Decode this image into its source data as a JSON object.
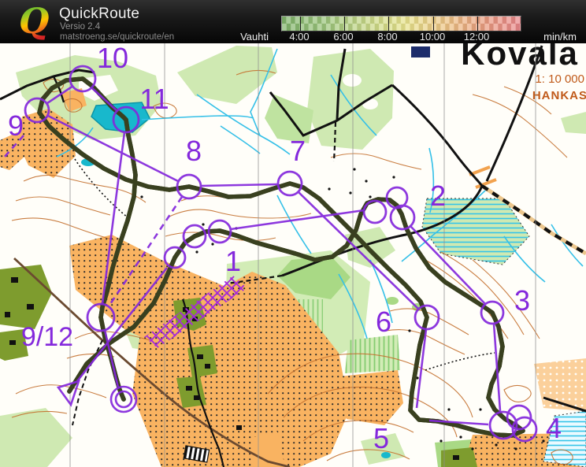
{
  "header": {
    "logo_letter": "Q",
    "app_title": "QuickRoute",
    "version": "Versio 2.4",
    "url": "matstroeng.se/quickroute/en",
    "legend": {
      "label": "Vauhti",
      "unit": "min/km",
      "tick_labels": [
        "4:00",
        "6:00",
        "8:00",
        "10:00",
        "12:00"
      ],
      "gradient_colors": [
        "#7fb36b",
        "#9cc57c",
        "#c8d887",
        "#e8e38c",
        "#edc083",
        "#ea9a80",
        "#e8868a"
      ]
    }
  },
  "map": {
    "title": "Kovala",
    "scale_text": "1: 10 000",
    "club_text": "HANKAS",
    "course_color": "#8428dc",
    "route_color": "#99a94c",
    "controls": [
      {
        "label": "1"
      },
      {
        "label": "2"
      },
      {
        "label": "3"
      },
      {
        "label": "4"
      },
      {
        "label": "5"
      },
      {
        "label": "6"
      },
      {
        "label": "7"
      },
      {
        "label": "8"
      },
      {
        "label": "9"
      },
      {
        "label": "10"
      },
      {
        "label": "11"
      },
      {
        "label": "9/12"
      }
    ]
  }
}
